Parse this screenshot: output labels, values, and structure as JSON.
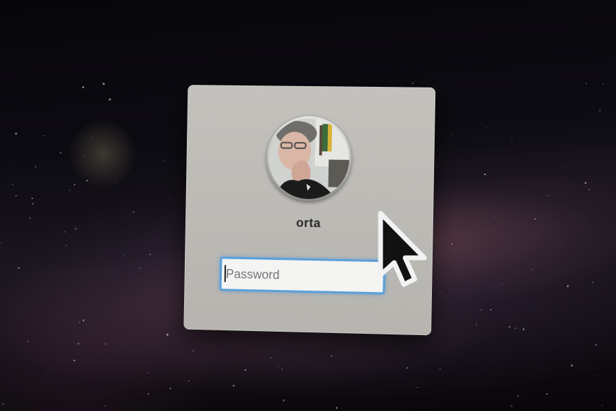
{
  "user": {
    "name": "orta"
  },
  "login": {
    "password_placeholder": "Password"
  },
  "icons": {
    "avatar": "user-photo",
    "cursor": "arrow-pointer-icon"
  },
  "colors": {
    "panel": "#bdbbb6",
    "focus_ring": "#5aa0d9",
    "desktop": "#0d0b12"
  }
}
